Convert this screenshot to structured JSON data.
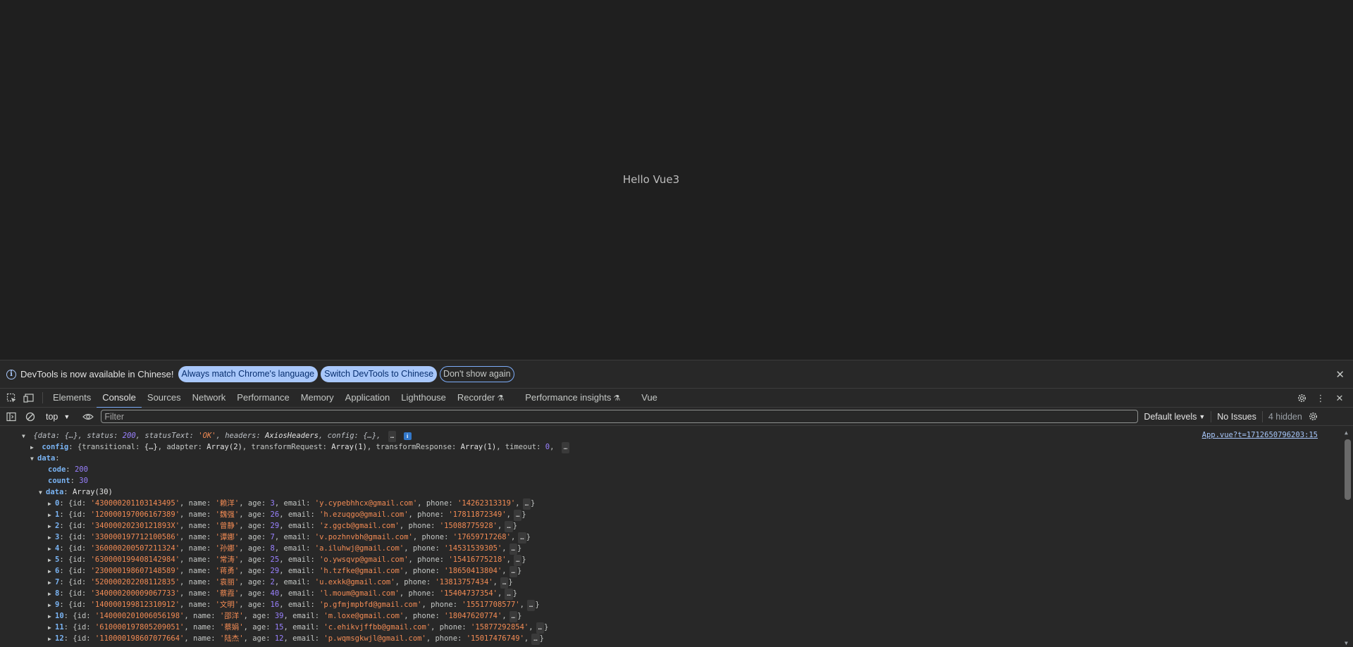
{
  "page": {
    "hello_text": "Hello Vue3"
  },
  "infobar": {
    "message": "DevTools is now available in Chinese!",
    "btn_match": "Always match Chrome's language",
    "btn_switch": "Switch DevTools to Chinese",
    "btn_dont_show": "Don't show again",
    "close": "✕"
  },
  "tabs": [
    {
      "label": "Elements"
    },
    {
      "label": "Console",
      "active": true
    },
    {
      "label": "Sources"
    },
    {
      "label": "Network"
    },
    {
      "label": "Performance"
    },
    {
      "label": "Memory"
    },
    {
      "label": "Application"
    },
    {
      "label": "Lighthouse"
    },
    {
      "label": "Recorder",
      "flask": true
    },
    {
      "label": "Performance insights",
      "flask": true
    },
    {
      "label": "Vue"
    }
  ],
  "toolbar": {
    "context": "top",
    "filter_placeholder": "Filter",
    "levels": "Default levels",
    "issues": "No Issues",
    "hidden": "4 hidden"
  },
  "console": {
    "source_link": "App.vue?t=1712650796203:15",
    "summary": {
      "data": "{…}",
      "status": "200",
      "statusText": "'OK'",
      "headers": "AxiosHeaders",
      "config": "{…}"
    },
    "config_line": {
      "transitional": "{…}",
      "adapter": "Array(2)",
      "transformRequest": "Array(1)",
      "transformResponse": "Array(1)",
      "timeout": "0"
    },
    "code": "200",
    "count": "30",
    "data_type": "Array(30)",
    "rows": [
      {
        "idx": "0",
        "id": "'430000201103143495'",
        "name": "'赖洋'",
        "age": "3",
        "email": "'y.cypebhhcx@gmail.com'",
        "phone": "'14262313319'"
      },
      {
        "idx": "1",
        "id": "'120000197006167389'",
        "name": "'魏强'",
        "age": "26",
        "email": "'h.ezuqgo@gmail.com'",
        "phone": "'17811872349'"
      },
      {
        "idx": "2",
        "id": "'34000020230121893X'",
        "name": "'曾静'",
        "age": "29",
        "email": "'z.ggcb@gmail.com'",
        "phone": "'15088775928'"
      },
      {
        "idx": "3",
        "id": "'330000197712100586'",
        "name": "'谭娜'",
        "age": "7",
        "email": "'v.pozhnvbh@gmail.com'",
        "phone": "'17659717268'"
      },
      {
        "idx": "4",
        "id": "'360000200507211324'",
        "name": "'孙娜'",
        "age": "8",
        "email": "'a.iluhwj@gmail.com'",
        "phone": "'14531539305'"
      },
      {
        "idx": "5",
        "id": "'630000199408142984'",
        "name": "'常涛'",
        "age": "25",
        "email": "'o.ywsqvp@gmail.com'",
        "phone": "'15416775218'"
      },
      {
        "idx": "6",
        "id": "'230000198607148589'",
        "name": "'蒋勇'",
        "age": "29",
        "email": "'h.tzfke@gmail.com'",
        "phone": "'18650413804'"
      },
      {
        "idx": "7",
        "id": "'520000202208112835'",
        "name": "'袁丽'",
        "age": "2",
        "email": "'u.exkk@gmail.com'",
        "phone": "'13813757434'"
      },
      {
        "idx": "8",
        "id": "'340000200009067733'",
        "name": "'蔡霞'",
        "age": "40",
        "email": "'l.moum@gmail.com'",
        "phone": "'15404737354'"
      },
      {
        "idx": "9",
        "id": "'140000199812310912'",
        "name": "'文明'",
        "age": "16",
        "email": "'p.gfmjmpbfd@gmail.com'",
        "phone": "'15517708577'"
      },
      {
        "idx": "10",
        "id": "'140000201006056198'",
        "name": "'邵洋'",
        "age": "39",
        "email": "'m.loxe@gmail.com'",
        "phone": "'18047620774'"
      },
      {
        "idx": "11",
        "id": "'610000197805209051'",
        "name": "'蔡娟'",
        "age": "15",
        "email": "'c.ehikvjffbb@gmail.com'",
        "phone": "'15877292854'"
      },
      {
        "idx": "12",
        "id": "'110000198607077664'",
        "name": "'陆杰'",
        "age": "12",
        "email": "'p.wqmsgkwjl@gmail.com'",
        "phone": "'15017476749'"
      }
    ]
  }
}
